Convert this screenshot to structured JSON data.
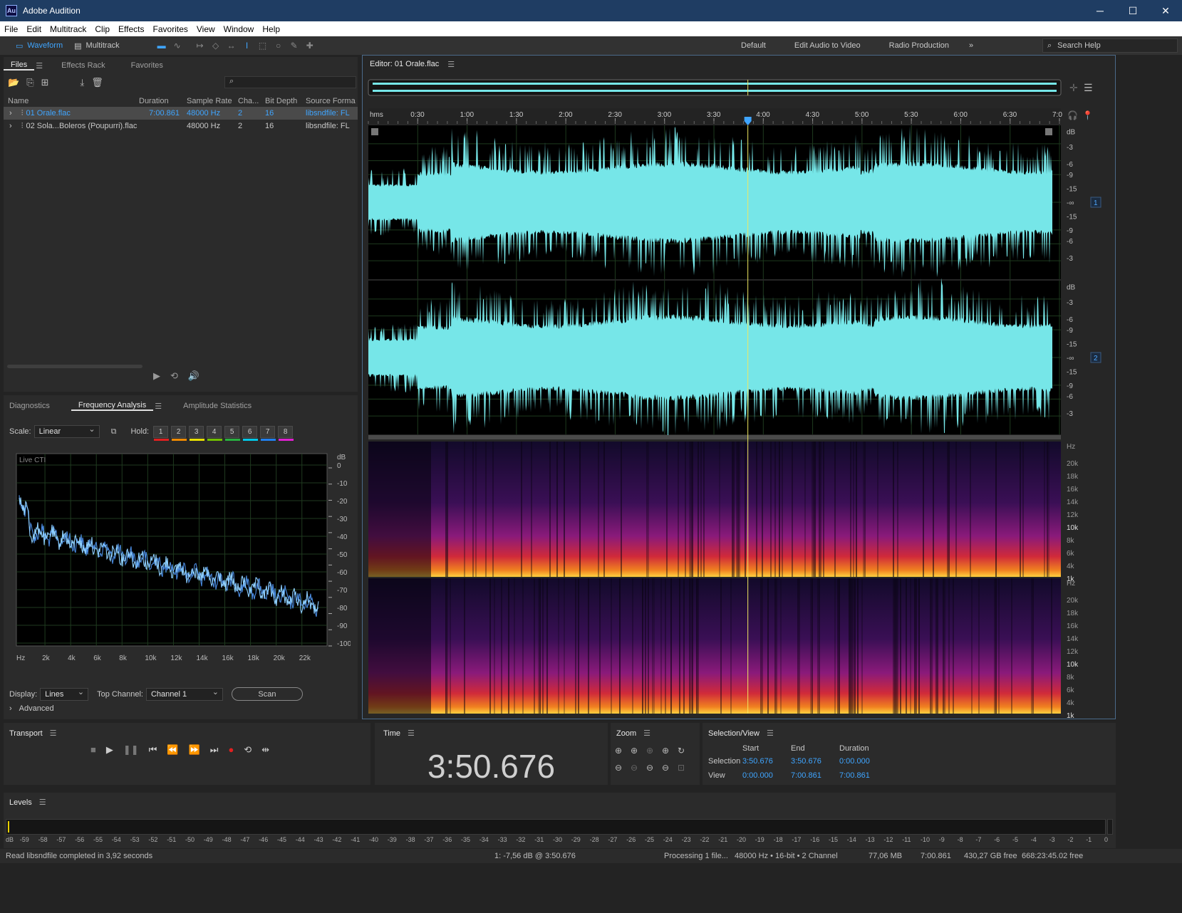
{
  "window": {
    "title": "Adobe Audition",
    "logo": "Au"
  },
  "menu": [
    "File",
    "Edit",
    "Multitrack",
    "Clip",
    "Effects",
    "Favorites",
    "View",
    "Window",
    "Help"
  ],
  "toolbar": {
    "waveform_label": "Waveform",
    "multitrack_label": "Multitrack",
    "workspaces": [
      "Default",
      "Edit Audio to Video",
      "Radio Production"
    ],
    "overflow": "»",
    "search_placeholder": "Search Help"
  },
  "files_panel": {
    "tabs": [
      "Files",
      "Effects Rack",
      "Favorites"
    ],
    "columns": [
      "Name",
      "Duration",
      "Sample Rate",
      "Cha...",
      "Bit Depth",
      "Source Forma"
    ],
    "rows": [
      {
        "name": "01 Orale.flac",
        "duration": "7:00.861",
        "rate": "48000 Hz",
        "ch": "2",
        "bits": "16",
        "format": "libsndfile: FL",
        "selected": true
      },
      {
        "name": "02 Sola...Boleros (Poupurri).flac",
        "duration": "",
        "rate": "48000 Hz",
        "ch": "2",
        "bits": "16",
        "format": "libsndfile: FL",
        "selected": false
      }
    ]
  },
  "freq_panel": {
    "tabs": [
      "Diagnostics",
      "Frequency Analysis",
      "Amplitude Statistics"
    ],
    "scale_label": "Scale:",
    "scale_value": "Linear",
    "hold_label": "Hold:",
    "hold_buttons": [
      "1",
      "2",
      "3",
      "4",
      "5",
      "6",
      "7",
      "8"
    ],
    "hold_colors": [
      "#e02020",
      "#f08a00",
      "#e8e000",
      "#70c000",
      "#28b040",
      "#00c8e8",
      "#2080f0",
      "#e020d0"
    ],
    "live_label": "Live CTI",
    "db_ticks": [
      "dB",
      "0",
      "-10",
      "-20",
      "-30",
      "-40",
      "-50",
      "-60",
      "-70",
      "-80",
      "-90",
      "-100"
    ],
    "hz_ticks": [
      "Hz",
      "2k",
      "4k",
      "6k",
      "8k",
      "10k",
      "12k",
      "14k",
      "16k",
      "18k",
      "20k",
      "22k"
    ],
    "display_label": "Display:",
    "display_value": "Lines",
    "top_channel_label": "Top Channel:",
    "top_channel_value": "Channel 1",
    "scan_label": "Scan",
    "advanced_label": "Advanced"
  },
  "editor": {
    "title": "Editor: 01 Orale.flac",
    "ruler": [
      "hms",
      "0:30",
      "1:00",
      "1:30",
      "2:00",
      "2:30",
      "3:00",
      "3:30",
      "4:00",
      "4:30",
      "5:00",
      "5:30",
      "6:00",
      "6:30",
      "7:0"
    ],
    "db_ticks": [
      "dB",
      "-3",
      "-6",
      "-9",
      "-15",
      "-∞",
      "-15",
      "-9",
      "-6",
      "-3"
    ],
    "channel_labels": [
      "1",
      "2"
    ],
    "hz_ticks": [
      "Hz",
      "20k",
      "18k",
      "16k",
      "14k",
      "12k",
      "10k",
      "8k",
      "6k",
      "4k",
      "1k"
    ],
    "playhead_fraction": 0.548,
    "wave_color": "#76e6e8"
  },
  "transport": {
    "title": "Transport"
  },
  "time": {
    "title": "Time",
    "value": "3:50.676"
  },
  "zoom": {
    "title": "Zoom"
  },
  "selection_view": {
    "title": "Selection/View",
    "headers": [
      "Start",
      "End",
      "Duration"
    ],
    "selection_label": "Selection",
    "view_label": "View",
    "selection": [
      "3:50.676",
      "3:50.676",
      "0:00.000"
    ],
    "view": [
      "0:00.000",
      "7:00.861",
      "7:00.861"
    ]
  },
  "levels": {
    "title": "Levels",
    "ticks": [
      "dB",
      "-59",
      "-58",
      "-57",
      "-56",
      "-55",
      "-54",
      "-53",
      "-52",
      "-51",
      "-50",
      "-49",
      "-48",
      "-47",
      "-46",
      "-45",
      "-44",
      "-43",
      "-42",
      "-41",
      "-40",
      "-39",
      "-38",
      "-37",
      "-36",
      "-35",
      "-34",
      "-33",
      "-32",
      "-31",
      "-30",
      "-29",
      "-28",
      "-27",
      "-26",
      "-25",
      "-24",
      "-23",
      "-22",
      "-21",
      "-20",
      "-19",
      "-18",
      "-17",
      "-16",
      "-15",
      "-14",
      "-13",
      "-12",
      "-11",
      "-10",
      "-9",
      "-8",
      "-7",
      "-6",
      "-5",
      "-4",
      "-3",
      "-2",
      "-1",
      "0"
    ]
  },
  "status": {
    "message": "Read libsndfile completed in 3,92 seconds",
    "cursor": "1: -7,56 dB @ 3:50.676",
    "processing": "Processing 1 file...",
    "format": "48000 Hz • 16-bit • 2 Channel",
    "size": "77,06 MB",
    "duration": "7:00.861",
    "free": "430,27 GB free",
    "free_time": "668:23:45.02 free"
  }
}
